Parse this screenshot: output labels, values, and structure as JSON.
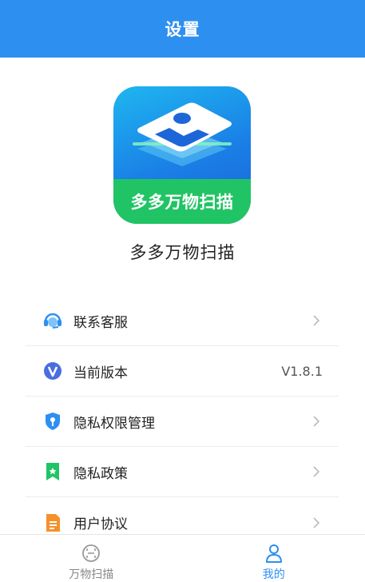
{
  "header": {
    "title": "设置"
  },
  "app": {
    "icon_banner_text": "多多万物扫描",
    "name": "多多万物扫描"
  },
  "menu": {
    "items": [
      {
        "label": "联系客服",
        "icon": "customer-service-icon"
      },
      {
        "label": "当前版本",
        "icon": "version-icon",
        "value": "V1.8.1"
      },
      {
        "label": "隐私权限管理",
        "icon": "privacy-permission-icon"
      },
      {
        "label": "隐私政策",
        "icon": "privacy-policy-icon"
      },
      {
        "label": "用户协议",
        "icon": "user-agreement-icon"
      }
    ]
  },
  "tabbar": {
    "tabs": [
      {
        "label": "万物扫描",
        "icon": "scan-icon",
        "active": false
      },
      {
        "label": "我的",
        "icon": "user-icon",
        "active": true
      }
    ]
  },
  "colors": {
    "primary": "#2d8ff0",
    "green": "#21c464"
  }
}
